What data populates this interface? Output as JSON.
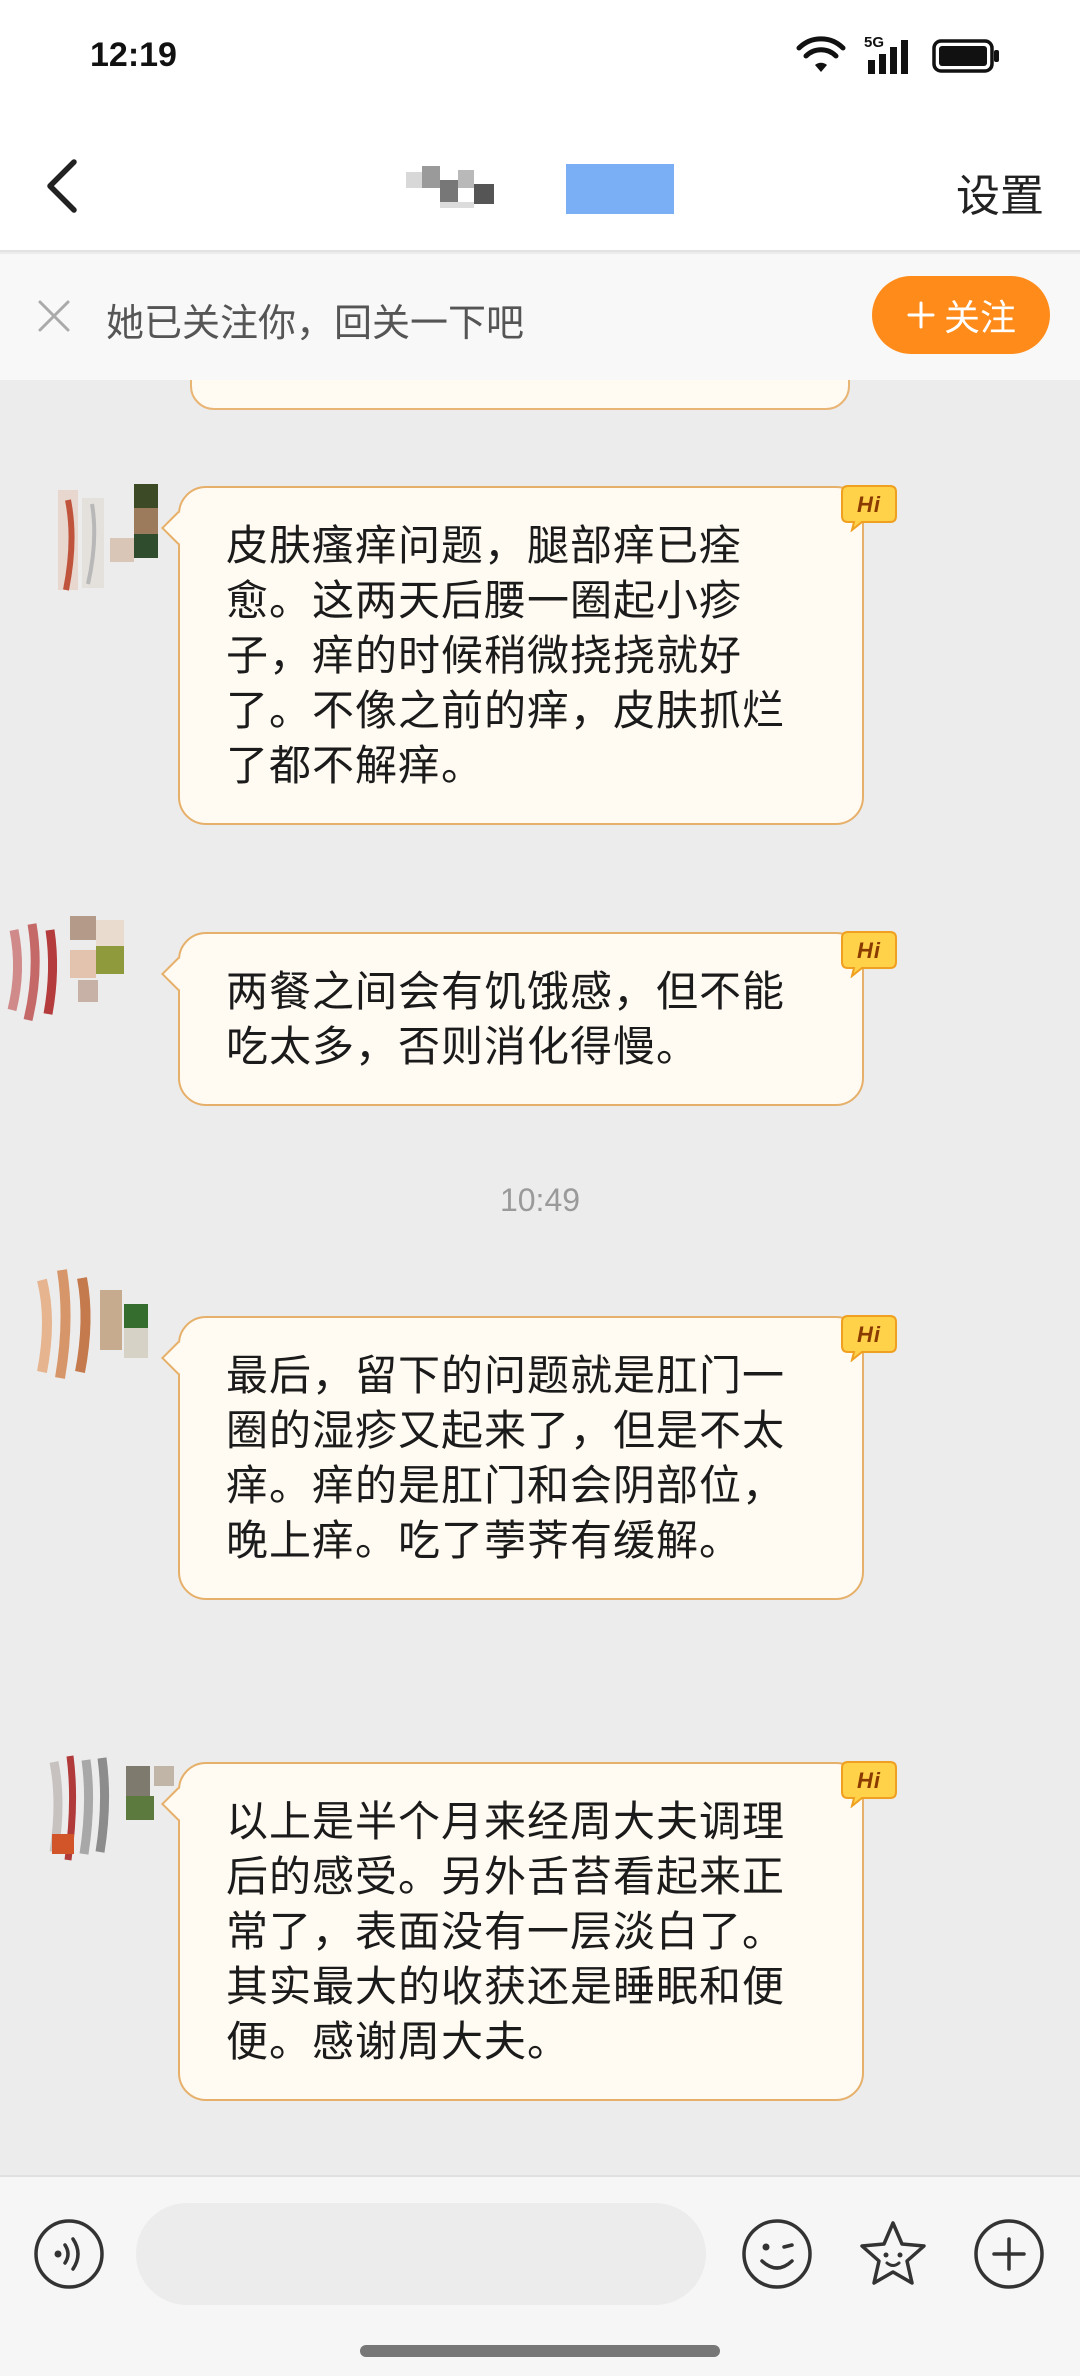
{
  "status_bar": {
    "time": "12:19",
    "network": "5G",
    "icons": [
      "wifi-icon",
      "cellular-signal-icon",
      "battery-icon"
    ]
  },
  "nav": {
    "back_icon": "chevron-left-icon",
    "settings_label": "设置"
  },
  "follow_banner": {
    "text": "她已关注你，回关一下吧",
    "button_label": "关注",
    "button_icon": "plus-icon",
    "accent": "#ff8c1a"
  },
  "chat": {
    "bubble_border": "#e6b06a",
    "bubble_bg": "#fffaf2",
    "messages": [
      {
        "text": "皮肤瘙痒问题，腿部痒已痊愈。这两天后腰一圈起小疹子，痒的时候稍微挠挠就好了。不像之前的痒，皮肤抓烂了都不解痒。",
        "badge": "Hi"
      },
      {
        "text": "两餐之间会有饥饿感，但不能吃太多，否则消化得慢。",
        "badge": "Hi"
      },
      {
        "text": "最后，留下的问题就是肛门一圈的湿疹又起来了，但是不太痒。痒的是肛门和会阴部位，晚上痒。吃了荸荠有缓解。",
        "badge": "Hi"
      },
      {
        "text": "以上是半个月来经周大夫调理后的感受。另外舌苔看起来正常了，表面没有一层淡白了。其实最大的收获还是睡眠和便便。感谢周大夫。",
        "badge": "Hi"
      }
    ],
    "timestamp": "10:49"
  },
  "input_bar": {
    "icons": [
      "voice-icon",
      "emoji-icon",
      "sticker-icon",
      "add-icon"
    ]
  }
}
